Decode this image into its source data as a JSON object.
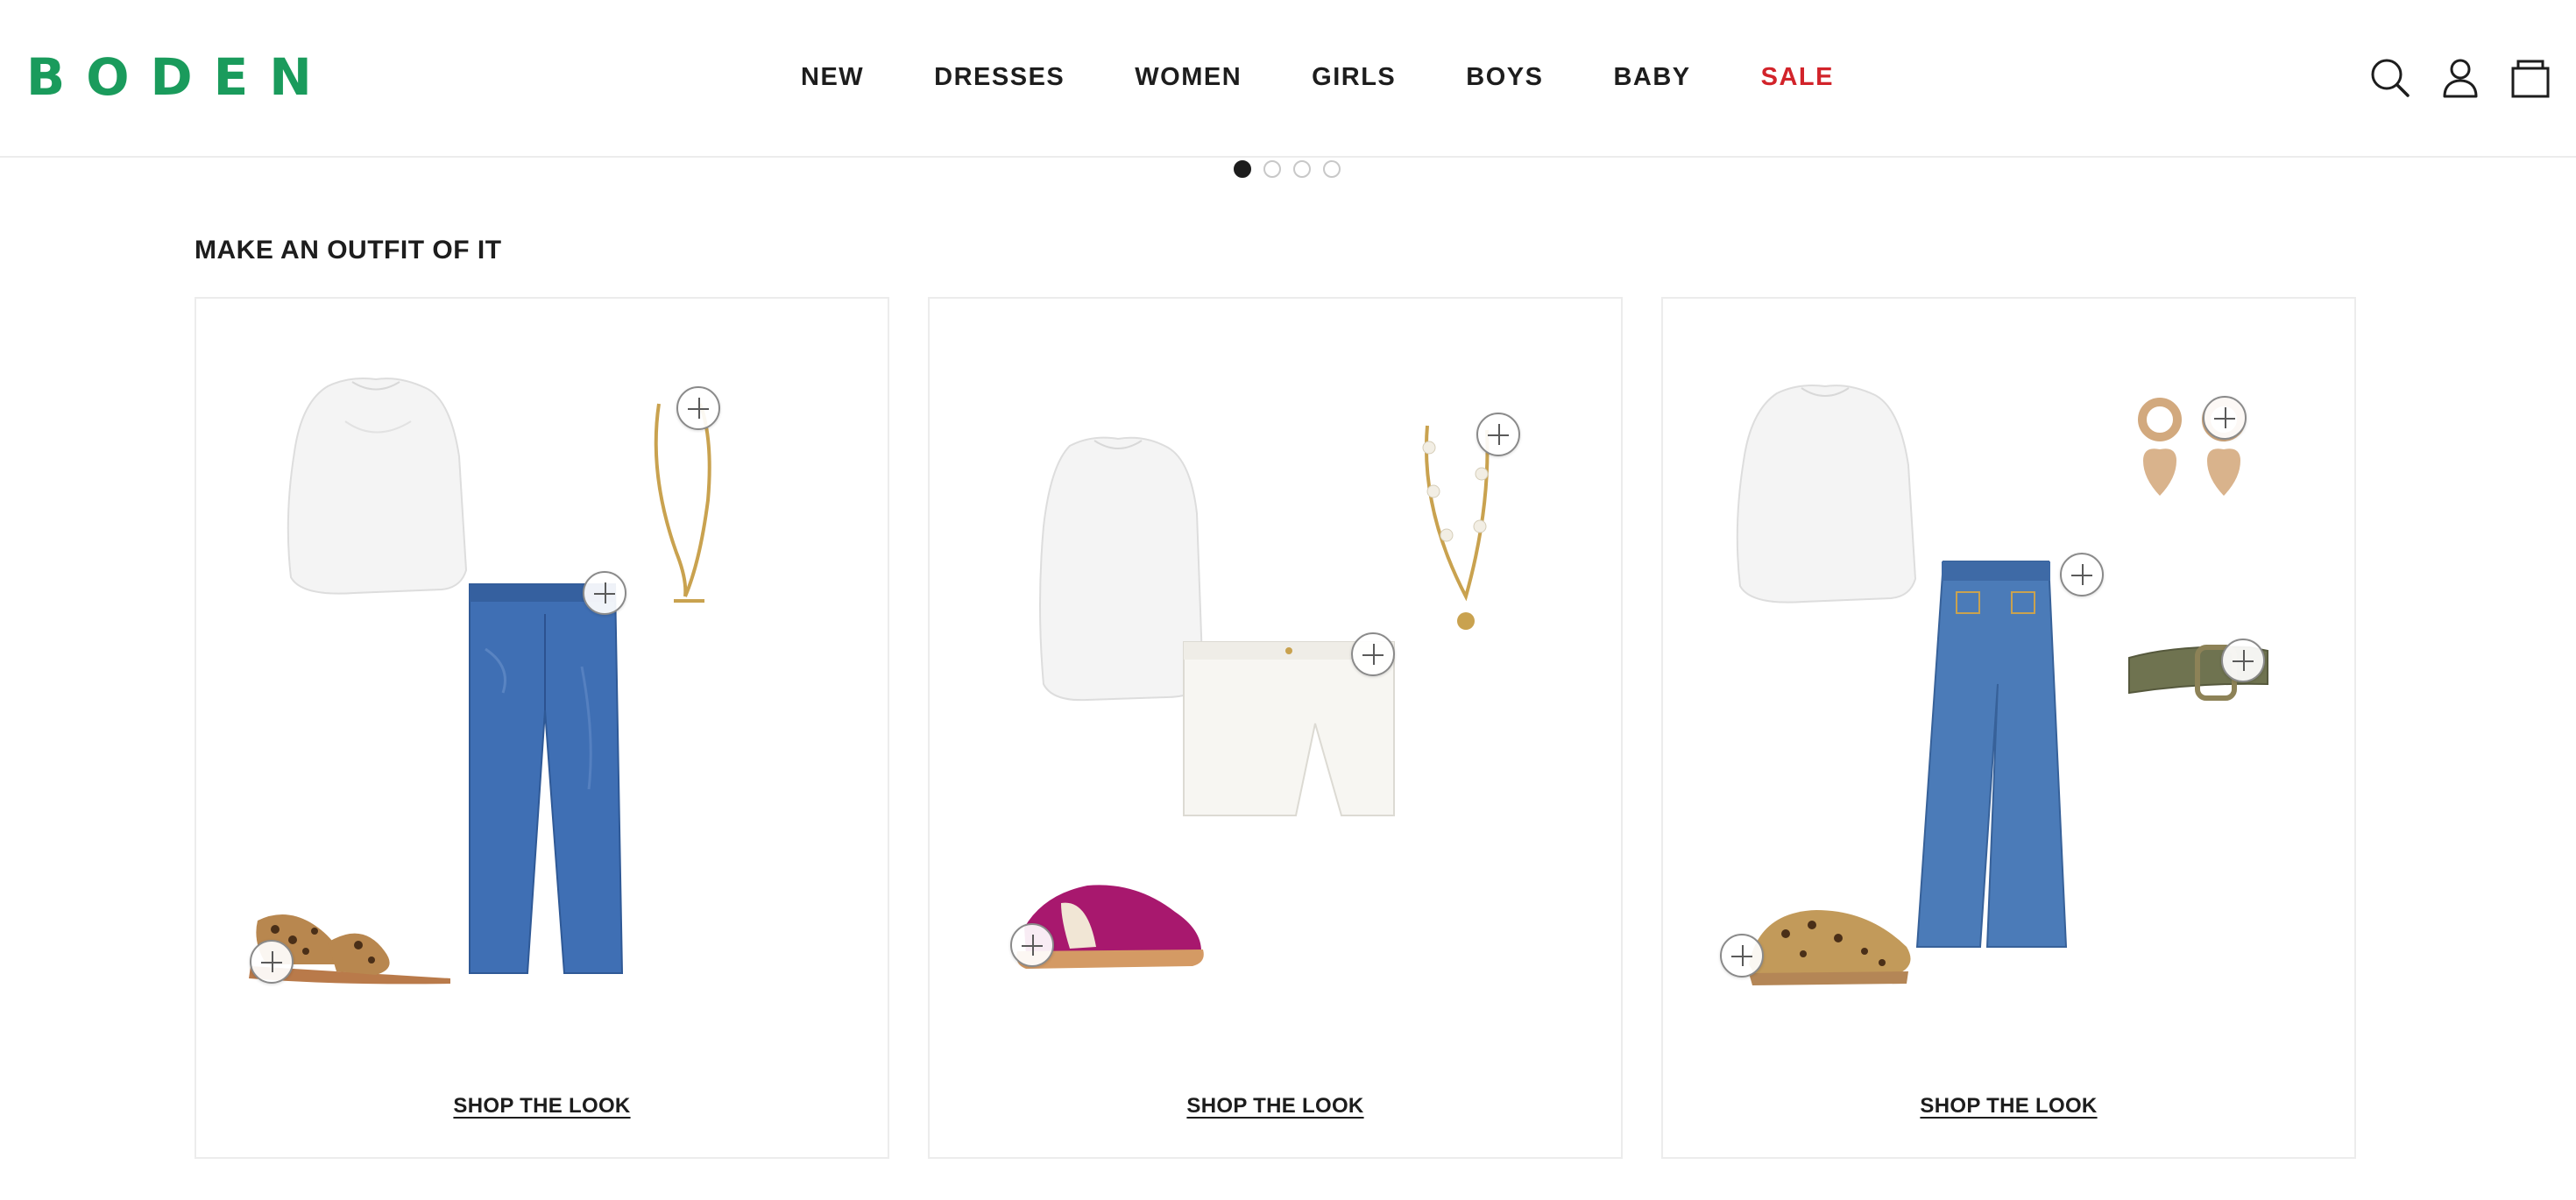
{
  "header": {
    "logo": "BODEN",
    "nav": [
      "NEW",
      "DRESSES",
      "WOMEN",
      "GIRLS",
      "BOYS",
      "BABY",
      "SALE"
    ],
    "icons": [
      "search-icon",
      "account-icon",
      "bag-icon"
    ]
  },
  "carousel": {
    "dots": 4,
    "active": 1
  },
  "section": {
    "title": "MAKE AN OUTFIT OF IT",
    "cards": [
      {
        "cta": "SHOP THE LOOK",
        "items": [
          "white blouse",
          "straight jeans",
          "gold necklace",
          "leopard sandals"
        ]
      },
      {
        "cta": "SHOP THE LOOK",
        "items": [
          "white blouse",
          "white shorts",
          "pearl necklace",
          "magenta trainers"
        ]
      },
      {
        "cta": "SHOP THE LOOK",
        "items": [
          "white blouse",
          "wide-leg jeans",
          "heart earrings",
          "khaki belt",
          "leopard clogs"
        ]
      }
    ]
  },
  "colors": {
    "brand": "#1a9b5c",
    "sale": "#d2232a",
    "text": "#1d1d1d"
  }
}
